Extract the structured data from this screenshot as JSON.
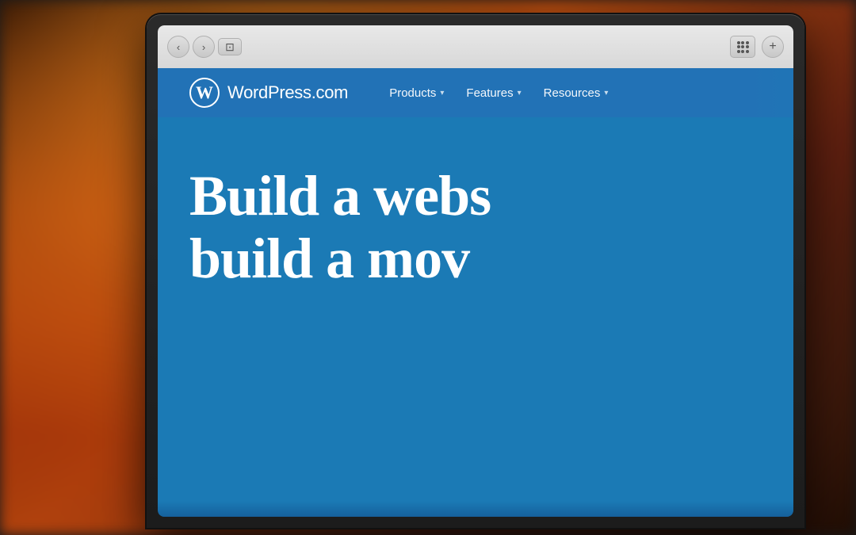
{
  "background": {
    "description": "Warm bokeh background with orange and brown tones"
  },
  "browser": {
    "nav": {
      "back_icon": "‹",
      "forward_icon": "›",
      "tab_icon": "⊡",
      "plus_icon": "+"
    }
  },
  "wordpress": {
    "logo": {
      "symbol": "W",
      "name": "WordPress.com"
    },
    "nav": {
      "items": [
        {
          "label": "Products",
          "has_dropdown": true
        },
        {
          "label": "Features",
          "has_dropdown": true
        },
        {
          "label": "Resources",
          "has_dropdown": true
        }
      ]
    },
    "hero": {
      "line1": "Build a webs",
      "line2": "build a mov"
    }
  },
  "colors": {
    "wp_blue": "#2272b6",
    "wp_hero_bg": "#1b7ab5",
    "nav_item_color": "#ffffff"
  }
}
